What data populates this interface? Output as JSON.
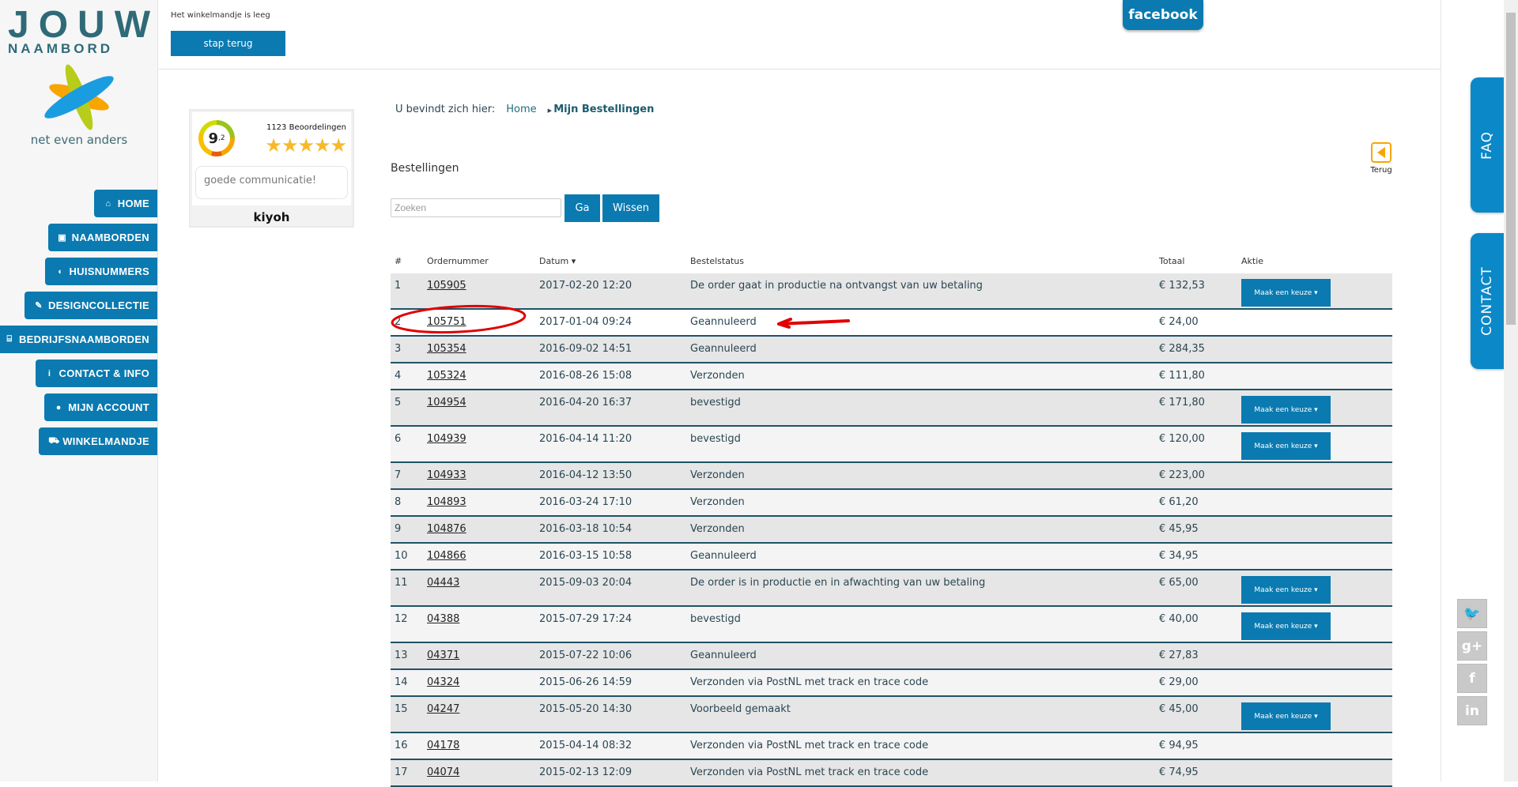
{
  "logo": {
    "word": "JOUW",
    "sub": "NAAMBORD",
    "tagline": "net even anders"
  },
  "nav": [
    {
      "label": "HOME",
      "icon": "home-icon",
      "glyph": "⌂"
    },
    {
      "label": "NAAMBORDEN",
      "icon": "image-icon",
      "glyph": "▣"
    },
    {
      "label": "HUISNUMMERS",
      "icon": "shield-icon",
      "glyph": "◖"
    },
    {
      "label": "DESIGNCOLLECTIE",
      "icon": "brush-icon",
      "glyph": "✎"
    },
    {
      "label": "BEDRIJFSNAAMBORDEN",
      "icon": "bank-icon",
      "glyph": "⌸"
    },
    {
      "label": "CONTACT & INFO",
      "icon": "info-icon",
      "glyph": "i"
    },
    {
      "label": "MIJN ACCOUNT",
      "icon": "user-icon",
      "glyph": "●"
    },
    {
      "label": "WINKELMANDJE",
      "icon": "cart-icon",
      "glyph": "⛟"
    }
  ],
  "header": {
    "cart_status": "Het winkelmandje is leeg",
    "back_button": "stap terug",
    "facebook": "facebook"
  },
  "kiyoh": {
    "score": "9",
    "score_decimal": ",2",
    "count": "1123 Beoordelingen",
    "stars": "★★★★★",
    "rating": 4.6,
    "quote": "goede communicatie!",
    "brand": "kiyoh"
  },
  "breadcrumb": {
    "prefix": "U bevindt zich hier:",
    "home": "Home",
    "current": "Mijn Bestellingen"
  },
  "title": "Bestellingen",
  "search": {
    "placeholder": "Zoeken",
    "go": "Ga",
    "clear": "Wissen"
  },
  "terug": "Terug",
  "table": {
    "headers": [
      "#",
      "Ordernummer",
      "Datum ▾",
      "Bestelstatus",
      "Totaal",
      "Aktie"
    ],
    "action_label": "Maak een keuze ▾",
    "rows": [
      {
        "n": "1",
        "order": "105905",
        "date": "2017-02-20 12:20",
        "status": "De order gaat in productie na ontvangst van uw betaling",
        "total": "€ 132,53",
        "action": true
      },
      {
        "n": "2",
        "order": "105751",
        "date": "2017-01-04 09:24",
        "status": "Geannuleerd",
        "total": "€ 24,00",
        "action": false
      },
      {
        "n": "3",
        "order": "105354",
        "date": "2016-09-02 14:51",
        "status": "Geannuleerd",
        "total": "€ 284,35",
        "action": false
      },
      {
        "n": "4",
        "order": "105324",
        "date": "2016-08-26 15:08",
        "status": "Verzonden",
        "total": "€ 111,80",
        "action": false
      },
      {
        "n": "5",
        "order": "104954",
        "date": "2016-04-20 16:37",
        "status": "bevestigd",
        "total": "€ 171,80",
        "action": true
      },
      {
        "n": "6",
        "order": "104939",
        "date": "2016-04-14 11:20",
        "status": "bevestigd",
        "total": "€ 120,00",
        "action": true
      },
      {
        "n": "7",
        "order": "104933",
        "date": "2016-04-12 13:50",
        "status": "Verzonden",
        "total": "€ 223,00",
        "action": false
      },
      {
        "n": "8",
        "order": "104893",
        "date": "2016-03-24 17:10",
        "status": "Verzonden",
        "total": "€ 61,20",
        "action": false
      },
      {
        "n": "9",
        "order": "104876",
        "date": "2016-03-18 10:54",
        "status": "Verzonden",
        "total": "€ 45,95",
        "action": false
      },
      {
        "n": "10",
        "order": "104866",
        "date": "2016-03-15 10:58",
        "status": "Geannuleerd",
        "total": "€ 34,95",
        "action": false
      },
      {
        "n": "11",
        "order": "04443",
        "date": "2015-09-03 20:04",
        "status": "De order is in productie en in afwachting van uw betaling",
        "total": "€ 65,00",
        "action": true
      },
      {
        "n": "12",
        "order": "04388",
        "date": "2015-07-29 17:24",
        "status": "bevestigd",
        "total": "€ 40,00",
        "action": true
      },
      {
        "n": "13",
        "order": "04371",
        "date": "2015-07-22 10:06",
        "status": "Geannuleerd",
        "total": "€ 27,83",
        "action": false
      },
      {
        "n": "14",
        "order": "04324",
        "date": "2015-06-26 14:59",
        "status": "Verzonden via PostNL met track en trace code",
        "total": "€ 29,00",
        "action": false
      },
      {
        "n": "15",
        "order": "04247",
        "date": "2015-05-20 14:30",
        "status": "Voorbeeld gemaakt",
        "total": "€ 45,00",
        "action": true
      },
      {
        "n": "16",
        "order": "04178",
        "date": "2015-04-14 08:32",
        "status": "Verzonden via PostNL met track en trace code",
        "total": "€ 94,95",
        "action": false
      },
      {
        "n": "17",
        "order": "04074",
        "date": "2015-02-13 12:09",
        "status": "Verzonden via PostNL met track en trace code",
        "total": "€ 74,95",
        "action": false
      }
    ]
  },
  "side_tabs": {
    "faq": "FAQ",
    "contact": "CONTACT"
  },
  "social": [
    {
      "icon": "twitter-icon",
      "glyph": "🐦"
    },
    {
      "icon": "google-plus-icon",
      "glyph": "g+"
    },
    {
      "icon": "facebook-icon",
      "glyph": "f"
    },
    {
      "icon": "linkedin-icon",
      "glyph": "in"
    }
  ],
  "colors": {
    "primary": "#0a7ab1",
    "accent": "#f7a600",
    "annotation": "#e00000"
  }
}
